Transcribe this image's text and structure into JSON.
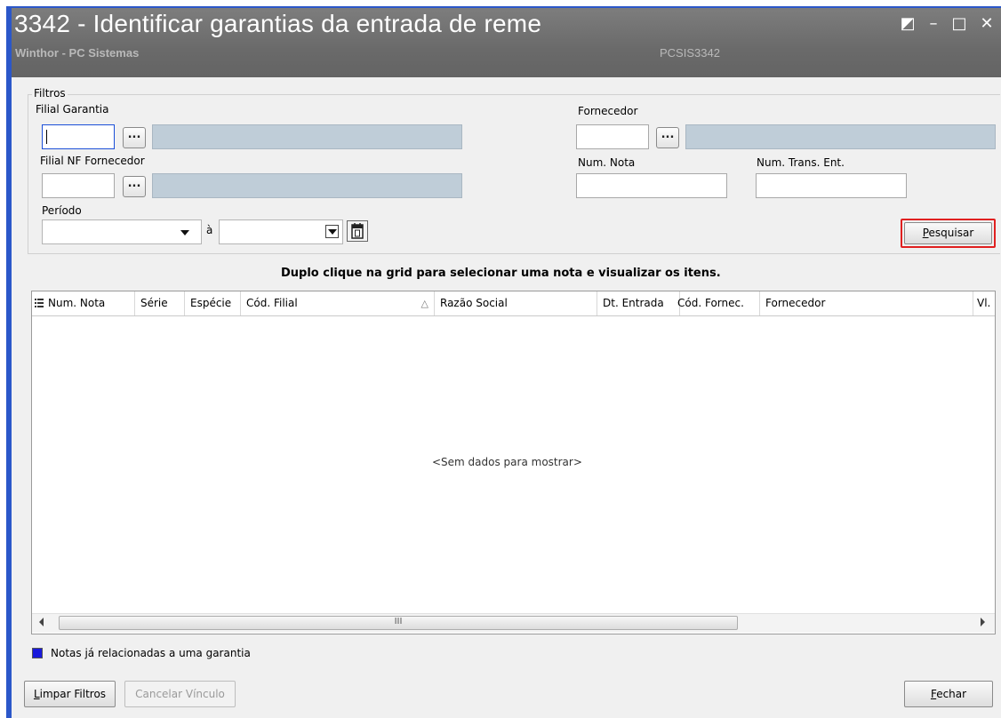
{
  "window": {
    "title": "3342 - Identificar garantias da entrada de reme",
    "app_name": "Winthor - PC Sistemas",
    "program_code": "PCSIS3342",
    "controls": {
      "restore_glyph": "◩",
      "minimize_glyph": "–",
      "maximize_glyph": "□",
      "close_glyph": "✕"
    }
  },
  "filters": {
    "group_label": "Filtros",
    "filial_garantia": {
      "label": "Filial Garantia",
      "value": "",
      "description": ""
    },
    "filial_nf_fornecedor": {
      "label": "Filial NF Fornecedor",
      "value": "",
      "description": ""
    },
    "periodo": {
      "label": "Período",
      "start": "",
      "separator": "à",
      "end": ""
    },
    "fornecedor": {
      "label": "Fornecedor",
      "value": "",
      "description": ""
    },
    "num_nota": {
      "label": "Num. Nota",
      "value": ""
    },
    "num_trans_ent": {
      "label": "Num. Trans. Ent.",
      "value": ""
    },
    "ellipsis_label": "...",
    "search_button": {
      "label": "Pesquisar",
      "hotkey": "P",
      "rest": "esquisar"
    }
  },
  "grid": {
    "hint": "Duplo clique na grid para selecionar uma nota e visualizar os itens.",
    "columns": [
      "Num. Nota",
      "Série",
      "Espécie",
      "Cód. Filial",
      "Razão Social",
      "Dt. Entrada",
      "Cód. Fornec.",
      "Fornecedor",
      "Vl."
    ],
    "sort_glyph": "△",
    "empty_text": "<Sem dados para mostrar>",
    "scroll_thumb_glyph": "III"
  },
  "legend": {
    "color": "#1a1adc",
    "text": "Notas já relacionadas a uma garantia"
  },
  "footer": {
    "clear_button": {
      "label": "Limpar Filtros",
      "hotkey": "L",
      "rest": "impar Filtros"
    },
    "cancel_button": {
      "label": "Cancelar Vínculo"
    },
    "close_button": {
      "label": "Fechar",
      "hotkey": "F",
      "rest": "echar"
    }
  },
  "colors": {
    "title_bar": "#6f6f6f",
    "window_border": "#2b57c9",
    "highlight": "#e02020"
  }
}
